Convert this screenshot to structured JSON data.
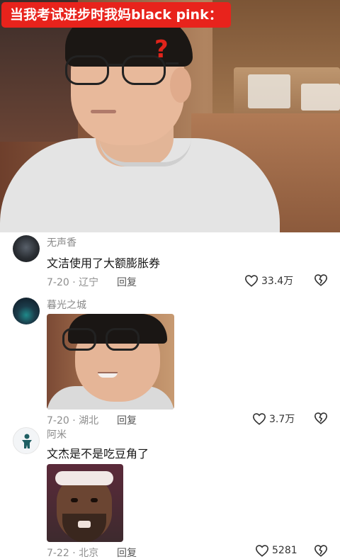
{
  "video": {
    "caption": "当我考试进步时我妈black pink：",
    "overlay_mark": "?"
  },
  "comments": [
    {
      "username": "无声香",
      "text": "文洁使用了大额膨胀券",
      "date_location": "7-20 · 辽宁",
      "reply_label": "回复",
      "likes": "33.4万"
    },
    {
      "username": "暮光之城",
      "text": "",
      "date_location": "7-20 · 湖北",
      "reply_label": "回复",
      "likes": "3.7万"
    },
    {
      "username": "阿米",
      "text": "文杰是不是吃豆角了",
      "date_location": "7-22 · 北京",
      "reply_label": "回复",
      "likes": "5281"
    }
  ],
  "colors": {
    "caption_bg": "#e8231c",
    "meta_text": "#8e8e8e"
  }
}
